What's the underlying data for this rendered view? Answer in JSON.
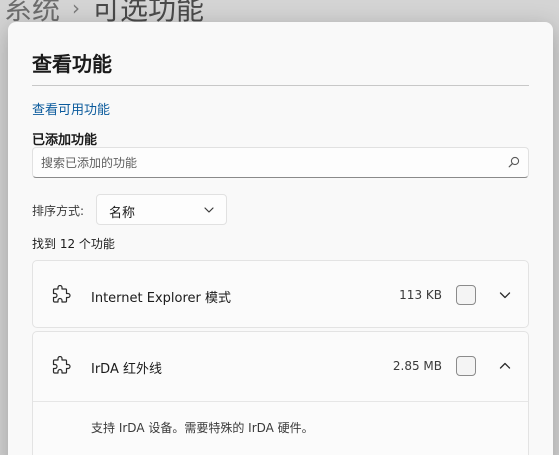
{
  "backdrop": {
    "parent": "系统",
    "separator": "›",
    "current": "可选功能"
  },
  "dialog": {
    "title": "查看功能",
    "view_available_link": "查看可用功能",
    "added_section_label": "已添加功能",
    "search": {
      "placeholder": "搜索已添加的功能",
      "value": ""
    },
    "sort": {
      "label": "排序方式:",
      "selected": "名称"
    },
    "result_count": "找到 12 个功能",
    "features": [
      {
        "name": "Internet Explorer 模式",
        "size": "113 KB",
        "checked": false,
        "expanded": false
      },
      {
        "name": "IrDA 红外线",
        "size": "2.85 MB",
        "checked": false,
        "expanded": true,
        "description": "支持 IrDA 设备。需要特殊的 IrDA 硬件。"
      }
    ]
  },
  "colors": {
    "link": "#0a5a9c",
    "surface": "#f9f9f9",
    "backdrop": "#d4d4d4"
  }
}
